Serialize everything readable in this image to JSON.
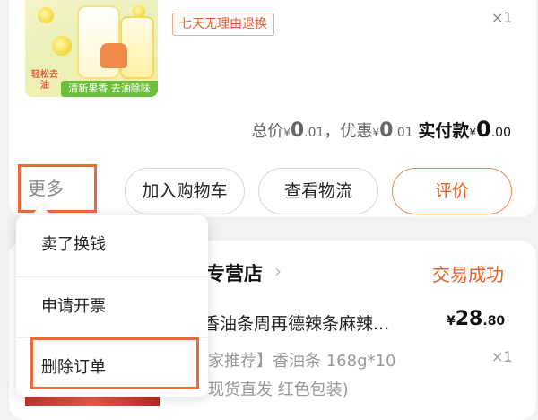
{
  "order1": {
    "thumbnail": {
      "badge_left": "轻松去油",
      "banner": "清新果香 去油除味"
    },
    "return_policy_badge": "七天无理由退换",
    "quantity": "×1",
    "price_summary": {
      "total_label": "总价",
      "total_symbol": "¥",
      "total_int": "0",
      "total_dec": ".01",
      "separator": "，",
      "discount_label": "优惠",
      "discount_symbol": "¥",
      "discount_int": "0",
      "discount_dec": ".01",
      "paid_label": "实付款",
      "paid_symbol": "¥",
      "paid_int": "0",
      "paid_dec": ".00"
    },
    "actions": {
      "more": "更多",
      "add_to_cart": "加入购物车",
      "view_logistics": "查看物流",
      "review": "评价"
    }
  },
  "more_menu": {
    "items": [
      "卖了换钱",
      "申请开票",
      "删除订单"
    ]
  },
  "order2": {
    "store_name": "专营店",
    "store_chevron": "›",
    "status": "交易成功",
    "product_title": "香油条周再德辣条麻辣...",
    "price_symbol": "¥",
    "price_int": "28",
    "price_dec": ".80",
    "spec_line1": "家推荐】香油条 168g*10",
    "quantity": "×1",
    "spec_line2": "现货直发 红色包装)"
  },
  "colors": {
    "accent": "#e6622a",
    "highlight_border": "#ef6a3a",
    "background": "#f2f2f2"
  }
}
